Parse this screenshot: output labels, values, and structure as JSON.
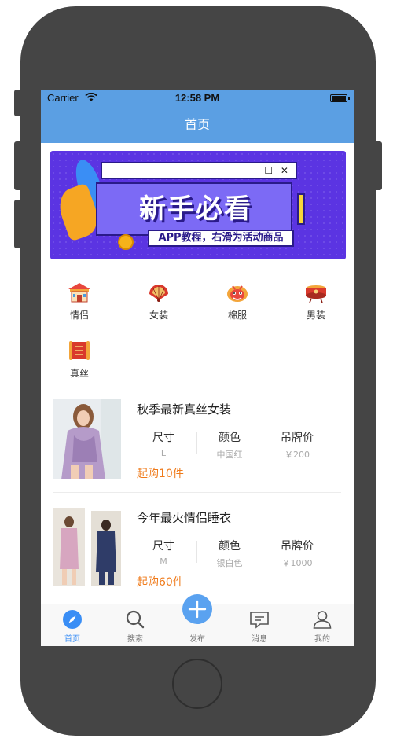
{
  "status_bar": {
    "carrier": "Carrier",
    "time": "12:58 PM"
  },
  "nav": {
    "title": "首页"
  },
  "banner": {
    "title": "新手必看",
    "subtitle": "APP教程，右滑为活动商品",
    "window_controls": "– ☐ ✕"
  },
  "categories": [
    {
      "label": "情侣",
      "icon": "pavilion-icon"
    },
    {
      "label": "女装",
      "icon": "fan-icon"
    },
    {
      "label": "棉服",
      "icon": "lion-head-icon"
    },
    {
      "label": "男装",
      "icon": "drum-icon"
    },
    {
      "label": "真丝",
      "icon": "scroll-icon"
    }
  ],
  "products": [
    {
      "name": "秋季最新真丝女装",
      "attrs": [
        {
          "key": "尺寸",
          "value": "L"
        },
        {
          "key": "颜色",
          "value": "中国红"
        },
        {
          "key": "吊牌价",
          "value": "￥200"
        }
      ],
      "moq": "起购10件"
    },
    {
      "name": "今年最火情侣睡衣",
      "attrs": [
        {
          "key": "尺寸",
          "value": "M"
        },
        {
          "key": "颜色",
          "value": "银白色"
        },
        {
          "key": "吊牌价",
          "value": "￥1000"
        }
      ],
      "moq": "起购60件"
    }
  ],
  "tabs": [
    {
      "label": "首页",
      "icon": "compass-icon",
      "active": true
    },
    {
      "label": "搜索",
      "icon": "search-icon",
      "active": false
    },
    {
      "label": "发布",
      "icon": "plus-icon",
      "active": false
    },
    {
      "label": "消息",
      "icon": "message-icon",
      "active": false
    },
    {
      "label": "我的",
      "icon": "person-icon",
      "active": false
    }
  ],
  "colors": {
    "nav": "#5b9fe3",
    "accent": "#3a8ef5",
    "moq": "#ef7a1a",
    "banner": "#5b34e2"
  }
}
